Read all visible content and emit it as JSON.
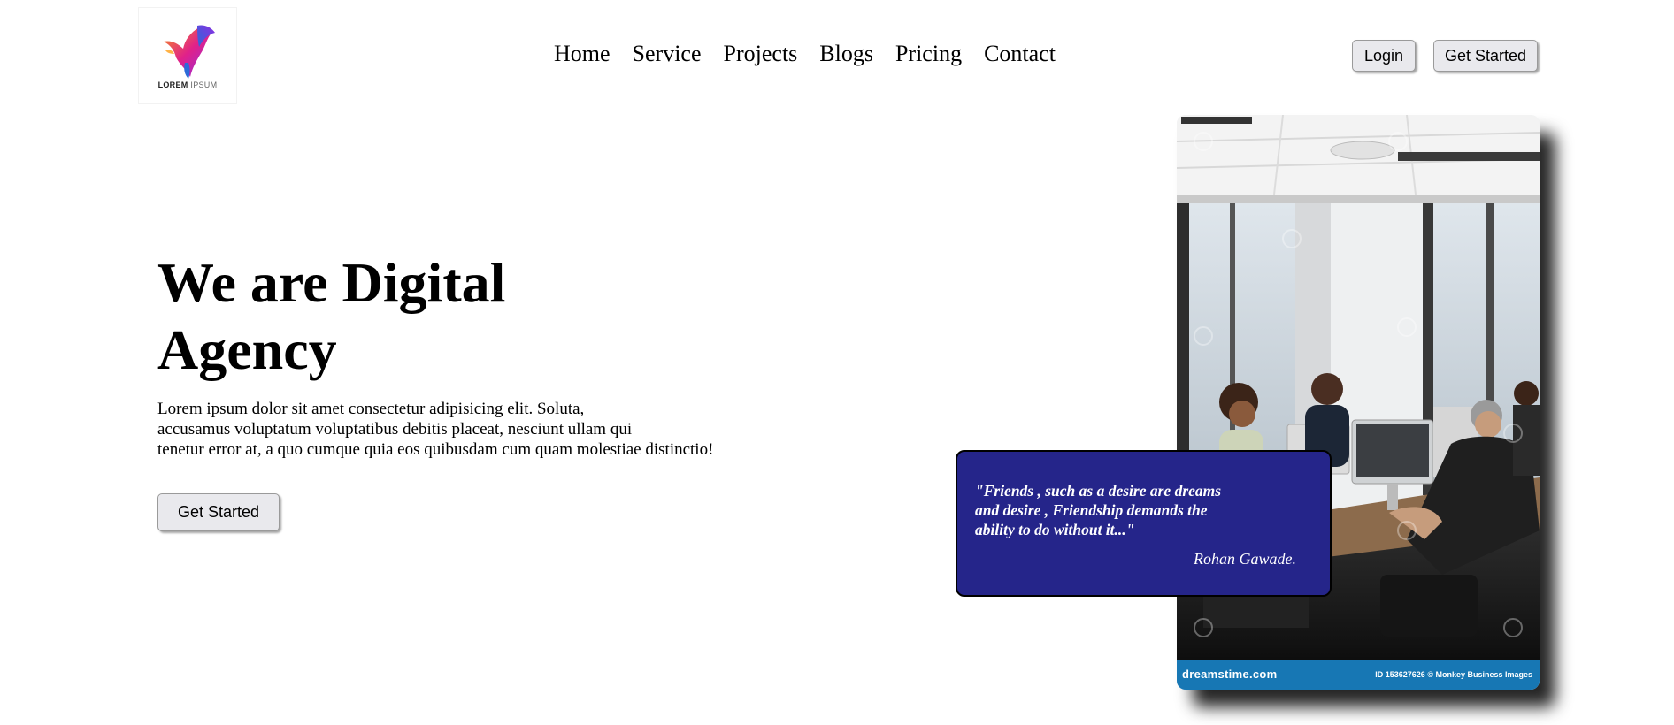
{
  "brand": {
    "logo_bold": "LOREM",
    "logo_light": "IPSUM",
    "colors": {
      "bird_orange": "#f7931e",
      "bird_purple": "#8e2de2",
      "bird_pink": "#e0218a"
    }
  },
  "nav": {
    "items": [
      "Home",
      "Service",
      "Projects",
      "Blogs",
      "Pricing",
      "Contact"
    ]
  },
  "header": {
    "login_label": "Login",
    "get_started_label": "Get Started"
  },
  "hero": {
    "title_line1": "We are Digital",
    "title_line2": "Agency",
    "description_line1": "Lorem ipsum dolor sit amet consectetur adipisicing elit. Soluta,",
    "description_line2": "accusamus voluptatum voluptatibus debitis placeat, nesciunt ullam qui",
    "description_line3": "tenetur error at, a quo cumque quia eos quibusdam cum quam molestiae distinctio!",
    "cta_label": "Get Started"
  },
  "photo": {
    "watermark_brand": "dreamstime.com",
    "watermark_credit": "ID 153627626 © Monkey Business Images",
    "footer_color": "#1777b4"
  },
  "quote": {
    "line1": "\"Friends , such as a desire are dreams",
    "line2": "and desire , Friendship demands the",
    "line3": "ability to do without it...\"",
    "author": "Rohan Gawade.",
    "background": "#25258a"
  }
}
